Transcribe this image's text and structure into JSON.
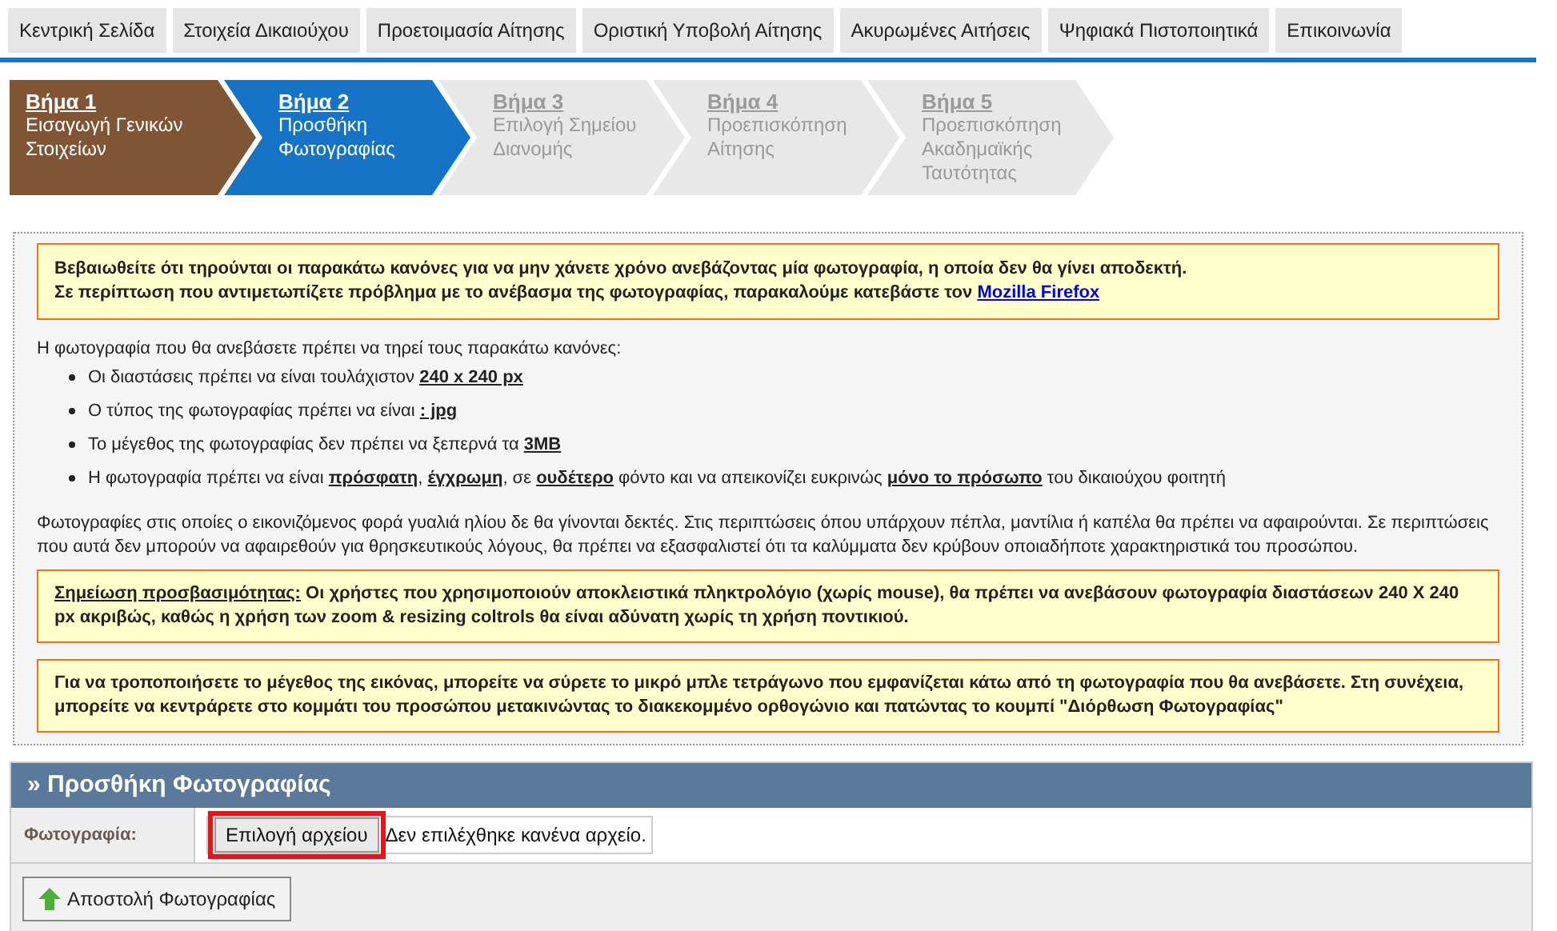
{
  "tabs": [
    {
      "label": "Κεντρική Σελίδα"
    },
    {
      "label": "Στοιχεία Δικαιούχου"
    },
    {
      "label": "Προετοιμασία Αίτησης"
    },
    {
      "label": "Οριστική Υποβολή Αίτησης"
    },
    {
      "label": "Ακυρωμένες Αιτήσεις"
    },
    {
      "label": "Ψηφιακά Πιστοποιητικά"
    },
    {
      "label": "Επικοινωνία"
    }
  ],
  "steps": [
    {
      "number": "Βήμα 1",
      "label": "Εισαγωγή Γενικών Στοιχείων",
      "completed": true,
      "selected": false
    },
    {
      "number": "Βήμα 2",
      "label": "Προσθήκη Φωτογραφίας",
      "completed": false,
      "selected": true
    },
    {
      "number": "Βήμα 3",
      "label": "Επιλογή Σημείου Διανομής",
      "completed": false,
      "selected": false
    },
    {
      "number": "Βήμα 4",
      "label": "Προεπισκόπηση Αίτησης",
      "completed": false,
      "selected": false
    },
    {
      "number": "Βήμα 5",
      "label": "Προεπισκόπηση Ακαδημαϊκής Ταυτότητας",
      "completed": false,
      "selected": false
    }
  ],
  "warning": {
    "line_1": "Βεβαιωθείτε ότι τηρούνται οι παρακάτω κανόνες για να μην χάνετε χρόνο ανεβάζοντας μία φωτογραφία, η οποία δεν θα γίνει αποδεκτή.",
    "line_2": "Σε περίπτωση που αντιμετωπίζετε πρόβλημα με το ανέβασμα της φωτογραφίας, παρακαλούμε κατεβάστε τον",
    "link": "Mozilla Firefox"
  },
  "rules_intro": "Η φωτογραφία που θα ανεβάσετε πρέπει να τηρεί τους παρακάτω κανόνες:",
  "rules": [
    "Οι διαστάσεις πρέπει να είναι τουλάχιστον **240 x 240 px**",
    "Ο τύπος της φωτογραφίας πρέπει να είναι **: jpg**",
    "Το μέγεθος της φωτογραφίας δεν πρέπει να ξεπερνά τα **3MB**",
    "Η φωτογραφία πρέπει να είναι **πρόσφατη**, **έγχρωμη**, σε **ουδέτερο** φόντο και να απεικονίζει ευκρινώς **μόνο το πρόσωπο** του δικαιούχου φοιτητή"
  ],
  "rules_note": "Φωτογραφίες στις οποίες ο εικονιζόμενος φορά γυαλιά ηλίου δε θα γίνονται δεκτές. Στις περιπτώσεις όπου υπάρχουν πέπλα, μαντίλια ή καπέλα θα πρέπει να αφαιρούνται. Σε περιπτώσεις που αυτά δεν μπορούν να αφαιρεθούν για θρησκευτικούς λόγους, θα πρέπει να εξασφαλιστεί ότι τα καλύμματα δεν κρύβουν οποιαδήποτε χαρακτηριστικά του προσώπου.",
  "accessibility_note": {
    "label": "Σημείωση προσβασιμότητας:",
    "text": "Οι χρήστες που χρησιμοποιούν αποκλειστικά πληκτρολόγιο (χωρίς mouse), θα πρέπει να ανεβάσουν φωτογραφία διαστάσεων 240 X 240 px ακριβώς, καθώς η χρήση των zoom & resizing coltrols θα είναι αδύνατη χωρίς τη χρήση ποντικιού."
  },
  "resize_note": "Για να τροποποιήσετε το μέγεθος της εικόνας, μπορείτε να σύρετε το μικρό μπλε τετράγωνο που εμφανίζεται κάτω από τη φωτογραφία που θα ανεβάσετε. Στη συνέχεια, μπορείτε να κεντράρετε στο κομμάτι του προσώπου μετακινώντας το διακεκομμένο ορθογώνιο και πατώντας το κουμπί \"Διόρθωση Φωτογραφίας\"",
  "upload_panel": {
    "title": "» Προσθήκη Φωτογραφίας",
    "field_label": "Φωτογραφία:",
    "file_button": "Επιλογή αρχείου",
    "file_status": "Δεν επιλέχθηκε κανένα αρχείο.",
    "submit_button": "Αποστολή Φωτογραφίας"
  }
}
